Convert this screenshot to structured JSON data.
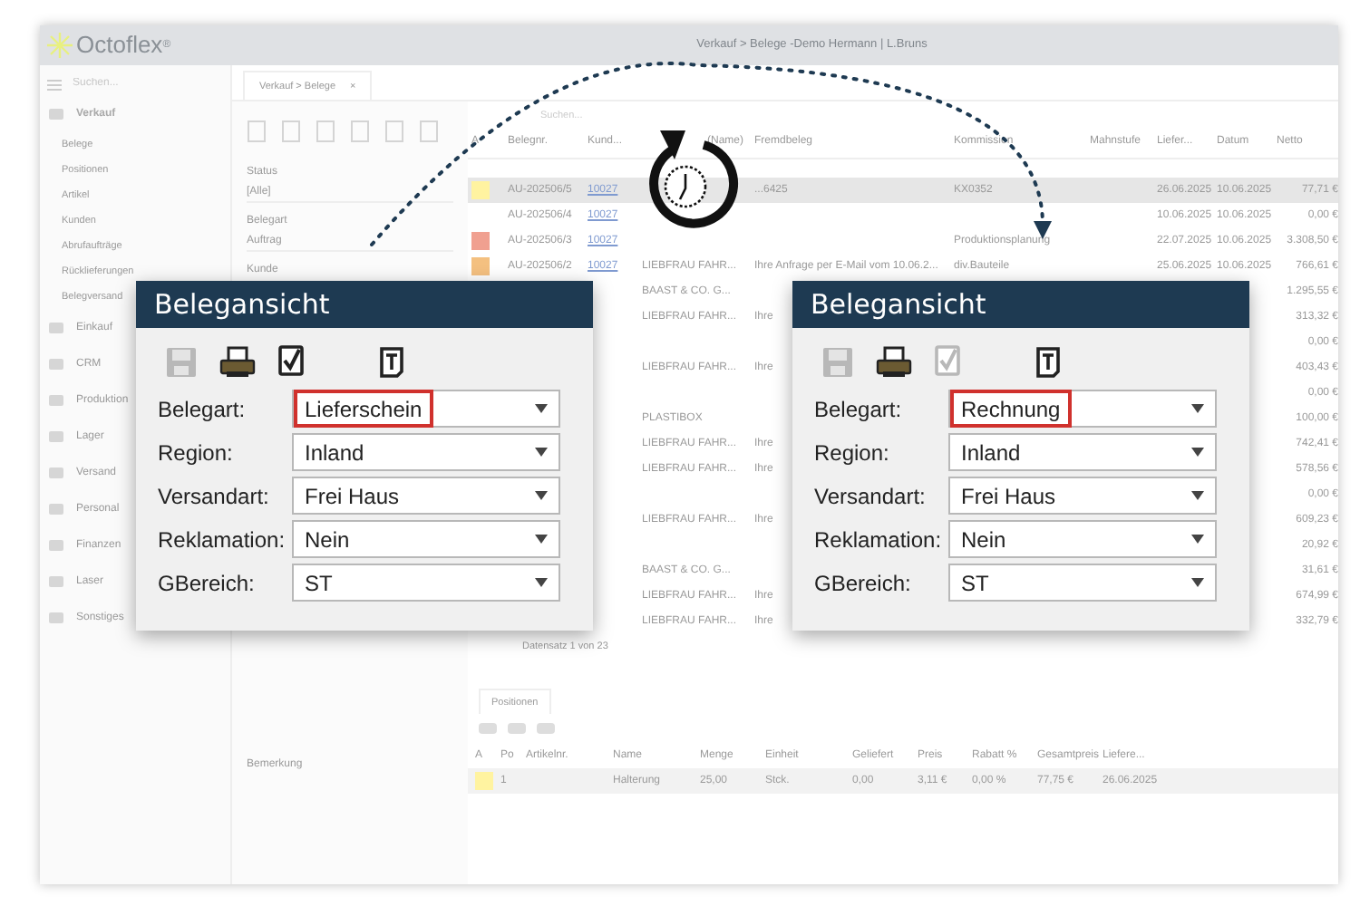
{
  "app": {
    "logo": "Octoflex",
    "logo_mark": "®",
    "title": "Verkauf > Belege -Demo Hermann | L.Bruns"
  },
  "sidebar": {
    "search": {
      "placeholder": "Suchen..."
    },
    "items": [
      {
        "label": "Verkauf",
        "expanded": true,
        "children": [
          {
            "label": "Belege"
          },
          {
            "label": "Positionen"
          },
          {
            "label": "Artikel"
          },
          {
            "label": "Kunden"
          },
          {
            "label": "Abrufaufträge"
          },
          {
            "label": "Rücklieferungen"
          },
          {
            "label": "Belegversand"
          }
        ]
      },
      {
        "label": "Einkauf",
        "expanded": false
      },
      {
        "label": "CRM",
        "expanded": false
      },
      {
        "label": "Produktion",
        "expanded": false
      },
      {
        "label": "Lager",
        "expanded": false
      },
      {
        "label": "Versand",
        "expanded": false
      },
      {
        "label": "Personal",
        "expanded": false
      },
      {
        "label": "Finanzen",
        "expanded": false
      },
      {
        "label": "Laser",
        "expanded": false
      },
      {
        "label": "Sonstiges",
        "expanded": false
      }
    ]
  },
  "tab": {
    "label": "Verkauf > Belege",
    "close": "×"
  },
  "filters": [
    {
      "label": "Status",
      "value": "[Alle]"
    },
    {
      "label": "Belegart",
      "value": "Auftrag"
    },
    {
      "label": "Kunde"
    }
  ],
  "remark_label": "Bemerkung",
  "table": {
    "search": {
      "placeholder": "Suchen..."
    },
    "columns": [
      "A",
      "Belegnr.",
      "Kund...",
      "(Name)",
      "Fremdbeleg",
      "Kommission",
      "Mahnstufe",
      "Liefer...",
      "Datum",
      "Netto"
    ],
    "rows": [
      {
        "color": "#fff3a0",
        "selected": true,
        "cells": [
          "",
          "AU-202506/5",
          "10027",
          "",
          "...6425",
          "KX0352",
          "",
          "26.06.2025",
          "10.06.2025",
          "77,71 €"
        ]
      },
      {
        "selected": false,
        "cells": [
          "",
          "AU-202506/4",
          "10027",
          "",
          "",
          "",
          "",
          "10.06.2025",
          "10.06.2025",
          "0,00 €"
        ]
      },
      {
        "color": "#f0a090",
        "selected": false,
        "cells": [
          "",
          "AU-202506/3",
          "10027",
          "",
          "",
          "Produktionsplanung",
          "",
          "22.07.2025",
          "10.06.2025",
          "3.308,50 €"
        ]
      },
      {
        "color": "#f4c080",
        "selected": false,
        "cells": [
          "",
          "AU-202506/2",
          "10027",
          "LIEBFRAU FAHR...",
          "Ihre Anfrage per E-Mail vom 10.06.2...",
          "div.Bauteile",
          "",
          "25.06.2025",
          "10.06.2025",
          "766,61 €"
        ]
      },
      {
        "selected": false,
        "cells": [
          "",
          "",
          "",
          "BAAST & CO. G...",
          "",
          "",
          "",
          "",
          "",
          "1.295,55 €"
        ]
      },
      {
        "selected": false,
        "cells": [
          "",
          "",
          "",
          "LIEBFRAU FAHR...",
          "Ihre",
          "",
          "",
          "",
          "",
          "313,32 €"
        ]
      },
      {
        "selected": false,
        "cells": [
          "",
          "",
          "",
          "",
          "",
          "",
          "",
          "",
          "",
          "0,00 €"
        ]
      },
      {
        "selected": false,
        "cells": [
          "",
          "",
          "",
          "LIEBFRAU FAHR...",
          "Ihre",
          "",
          "",
          "",
          "",
          "403,43 €"
        ]
      },
      {
        "selected": false,
        "cells": [
          "",
          "",
          "",
          "",
          "",
          "",
          "",
          "",
          "",
          "0,00 €"
        ]
      },
      {
        "selected": false,
        "cells": [
          "",
          "",
          "",
          "PLASTIBOX",
          "",
          "",
          "",
          "",
          "",
          "100,00 €"
        ]
      },
      {
        "selected": false,
        "cells": [
          "",
          "",
          "",
          "LIEBFRAU FAHR...",
          "Ihre",
          "",
          "",
          "",
          "",
          "742,41 €"
        ]
      },
      {
        "selected": false,
        "cells": [
          "",
          "",
          "",
          "LIEBFRAU FAHR...",
          "Ihre",
          "",
          "",
          "",
          "",
          "578,56 €"
        ]
      },
      {
        "selected": false,
        "cells": [
          "",
          "",
          "",
          "",
          "",
          "",
          "",
          "",
          "",
          "0,00 €"
        ]
      },
      {
        "selected": false,
        "cells": [
          "",
          "",
          "",
          "LIEBFRAU FAHR...",
          "Ihre",
          "",
          "",
          "",
          "",
          "609,23 €"
        ]
      },
      {
        "selected": false,
        "cells": [
          "",
          "",
          "",
          "",
          "",
          "",
          "",
          "",
          "",
          "20,92 €"
        ]
      },
      {
        "selected": false,
        "cells": [
          "",
          "",
          "",
          "BAAST & CO. G...",
          "",
          "",
          "",
          "",
          "",
          "31,61 €"
        ]
      },
      {
        "selected": false,
        "cells": [
          "",
          "",
          "",
          "LIEBFRAU FAHR...",
          "Ihre",
          "",
          "",
          "",
          "",
          "674,99 €"
        ]
      },
      {
        "selected": false,
        "cells": [
          "",
          "",
          "",
          "LIEBFRAU FAHR...",
          "Ihre",
          "",
          "",
          "",
          "",
          "332,79 €"
        ]
      }
    ],
    "pager": "Datensatz 1 von 23"
  },
  "positions": {
    "tab": "Positionen",
    "columns": [
      "A",
      "Po",
      "Artikelnr.",
      "Name",
      "Menge",
      "Einheit",
      "Geliefert",
      "Preis",
      "Rabatt %",
      "Gesamtpreis",
      "Liefere..."
    ],
    "rows": [
      {
        "color": "#fff3a0",
        "cells": [
          "",
          "1",
          "",
          "Halterung",
          "25,00",
          "Stck.",
          "0,00",
          "3,11 €",
          "0,00 %",
          "77,75 €",
          "26.06.2025"
        ]
      }
    ]
  },
  "dialogs": [
    {
      "title": "Belegansicht",
      "toolbar": [
        {
          "kind": "save",
          "disabled": true
        },
        {
          "kind": "print",
          "disabled": false
        },
        {
          "kind": "check",
          "disabled": false
        },
        {
          "kind": "text",
          "disabled": false
        }
      ],
      "fields": [
        {
          "label": "Belegart:",
          "value": "Lieferschein",
          "highlighted": true
        },
        {
          "label": "Region:",
          "value": "Inland",
          "highlighted": false
        },
        {
          "label": "Versandart:",
          "value": "Frei Haus",
          "highlighted": false
        },
        {
          "label": "Reklamation:",
          "value": "Nein",
          "highlighted": false
        },
        {
          "label": "GBereich:",
          "value": "ST",
          "highlighted": false
        }
      ]
    },
    {
      "title": "Belegansicht",
      "toolbar": [
        {
          "kind": "save",
          "disabled": true
        },
        {
          "kind": "print",
          "disabled": false
        },
        {
          "kind": "check",
          "disabled": true
        },
        {
          "kind": "text",
          "disabled": false
        }
      ],
      "fields": [
        {
          "label": "Belegart:",
          "value": "Rechnung",
          "highlighted": true
        },
        {
          "label": "Region:",
          "value": "Inland",
          "highlighted": false
        },
        {
          "label": "Versandart:",
          "value": "Frei Haus",
          "highlighted": false
        },
        {
          "label": "Reklamation:",
          "value": "Nein",
          "highlighted": false
        },
        {
          "label": "GBereich:",
          "value": "ST",
          "highlighted": false
        }
      ]
    }
  ]
}
